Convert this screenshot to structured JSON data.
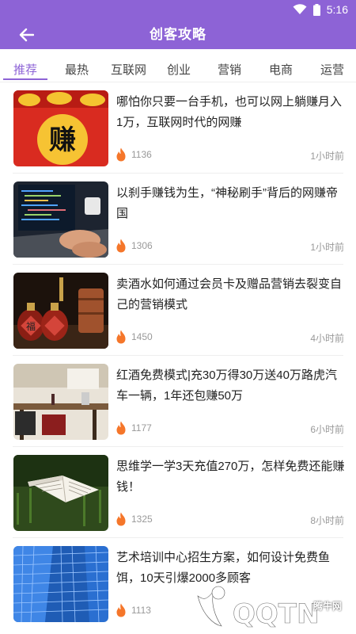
{
  "status_bar": {
    "time": "5:16",
    "icons": [
      "wifi-icon",
      "battery-icon"
    ]
  },
  "app_bar": {
    "title": "创客攻略",
    "back_icon": "arrow-left-icon"
  },
  "colors": {
    "accent": "#8d63d6",
    "flame": "#f5762a",
    "text_secondary": "#999999"
  },
  "tabs": [
    {
      "label": "推荐",
      "active": true
    },
    {
      "label": "最热",
      "active": false
    },
    {
      "label": "互联网",
      "active": false
    },
    {
      "label": "创业",
      "active": false
    },
    {
      "label": "营销",
      "active": false
    },
    {
      "label": "电商",
      "active": false
    },
    {
      "label": "运营",
      "active": false
    }
  ],
  "articles": [
    {
      "title": "哪怕你只要一台手机，也可以网上躺赚月入1万，互联网时代的网赚",
      "views": "1136",
      "time": "1小时前",
      "thumb_text": "赚"
    },
    {
      "title": "以刹手赚钱为生，“神秘刷手”背后的网赚帝国",
      "views": "1306",
      "time": "1小时前"
    },
    {
      "title": "卖酒水如何通过会员卡及赠品营销去裂变自己的营销模式",
      "views": "1450",
      "time": "4小时前",
      "thumb_text": "福"
    },
    {
      "title": "红酒免费模式|充30万得30万送40万路虎汽车一辆，1年还包赚50万",
      "views": "1177",
      "time": "6小时前"
    },
    {
      "title": "思维学一学3天充值270万，怎样免费还能赚钱！",
      "views": "1325",
      "time": "8小时前"
    },
    {
      "title": "艺术培训中心招生方案，如何设计免费鱼饵，10天引爆2000多顾客",
      "views": "1113",
      "time": ""
    }
  ],
  "watermark": {
    "text": "腾牛网",
    "logo_text": "QQTN"
  }
}
